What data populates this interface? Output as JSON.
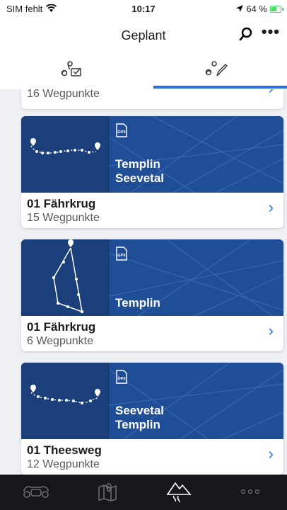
{
  "status_bar": {
    "carrier": "SIM fehlt",
    "time": "10:17",
    "battery_percent": "64 %",
    "battery_level": 0.64,
    "icons": [
      "wifi-icon",
      "location-arrow-icon",
      "battery-charging-icon"
    ]
  },
  "nav": {
    "title": "Geplant",
    "search_icon": "search-icon",
    "more_icon": "more-icon",
    "more_label": "•••"
  },
  "tabs": [
    {
      "icon": "saved-routes-icon",
      "selected": false
    },
    {
      "icon": "edit-route-icon",
      "selected": true
    }
  ],
  "list": {
    "partial_card": {
      "waypoints": "16 Wegpunkte"
    },
    "cards": [
      {
        "route_title": [
          "Templin",
          "Seevetal"
        ],
        "name": "01 Fährkrug",
        "waypoints": "15 Wegpunkte",
        "badge": "GPX"
      },
      {
        "route_title": [
          "Templin"
        ],
        "name": "01 Fährkrug",
        "waypoints": "6 Wegpunkte",
        "badge": "GPX"
      },
      {
        "route_title": [
          "Seevetal",
          "Templin"
        ],
        "name": "01 Theesweg",
        "waypoints": "12 Wegpunkte",
        "badge": "GPX"
      }
    ],
    "chevron": "›"
  },
  "tab_bar": {
    "items": [
      {
        "icon": "motorcycle-icon",
        "selected": false
      },
      {
        "icon": "map-icon",
        "selected": false
      },
      {
        "icon": "routes-mountain-icon",
        "selected": true
      },
      {
        "icon": "more-dots-icon",
        "selected": false
      }
    ]
  },
  "colors": {
    "accent": "#2a6fdb",
    "card_image_blue": "#1f4e96",
    "tab_bar_bg": "#16171b"
  }
}
